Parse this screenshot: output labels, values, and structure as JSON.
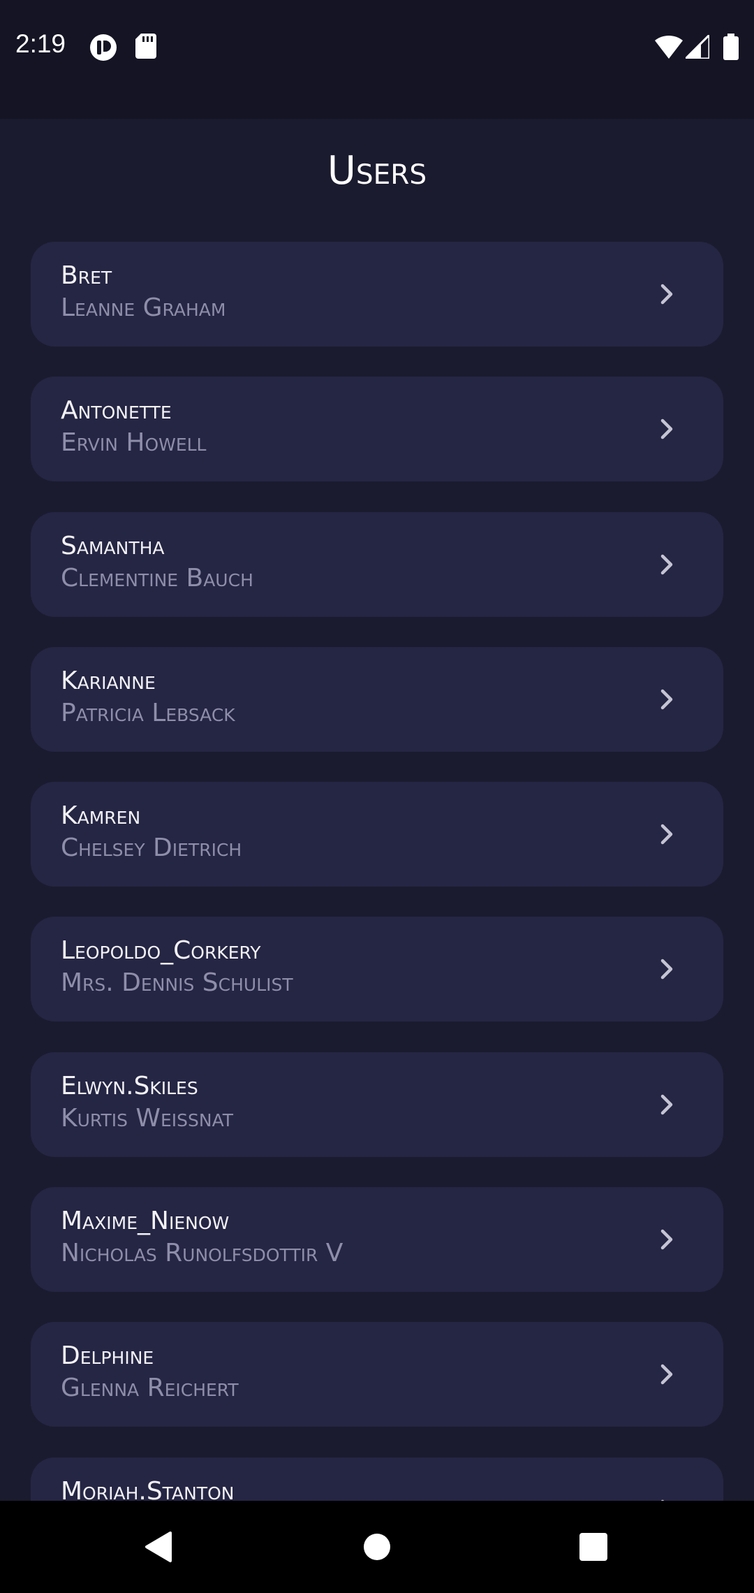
{
  "status_bar": {
    "time": "2:19",
    "left_icons": [
      "media-session-icon",
      "sd-card-icon"
    ],
    "right_icons": [
      "wifi-icon",
      "cellular-signal-icon",
      "battery-icon"
    ]
  },
  "header": {
    "title": "Users"
  },
  "users": [
    {
      "username": "Bret",
      "name": "Leanne Graham"
    },
    {
      "username": "Antonette",
      "name": "Ervin Howell"
    },
    {
      "username": "Samantha",
      "name": "Clementine Bauch"
    },
    {
      "username": "Karianne",
      "name": "Patricia Lebsack"
    },
    {
      "username": "Kamren",
      "name": "Chelsey Dietrich"
    },
    {
      "username": "Leopoldo_Corkery",
      "name": "Mrs. Dennis Schulist"
    },
    {
      "username": "Elwyn.Skiles",
      "name": "Kurtis Weissnat"
    },
    {
      "username": "Maxime_Nienow",
      "name": "Nicholas Runolfsdottir V"
    },
    {
      "username": "Delphine",
      "name": "Glenna Reichert"
    },
    {
      "username": "Moriah.Stanton",
      "name": ""
    }
  ],
  "colors": {
    "background": "#1b1b2f",
    "card": "#252544",
    "status_bar": "#141424",
    "primary_text": "#f2f2f6",
    "secondary_text": "#8e8eaa",
    "chevron": "#c4c4d4"
  },
  "nav_bar": {
    "buttons": [
      "back-icon",
      "home-icon",
      "recents-icon"
    ]
  }
}
